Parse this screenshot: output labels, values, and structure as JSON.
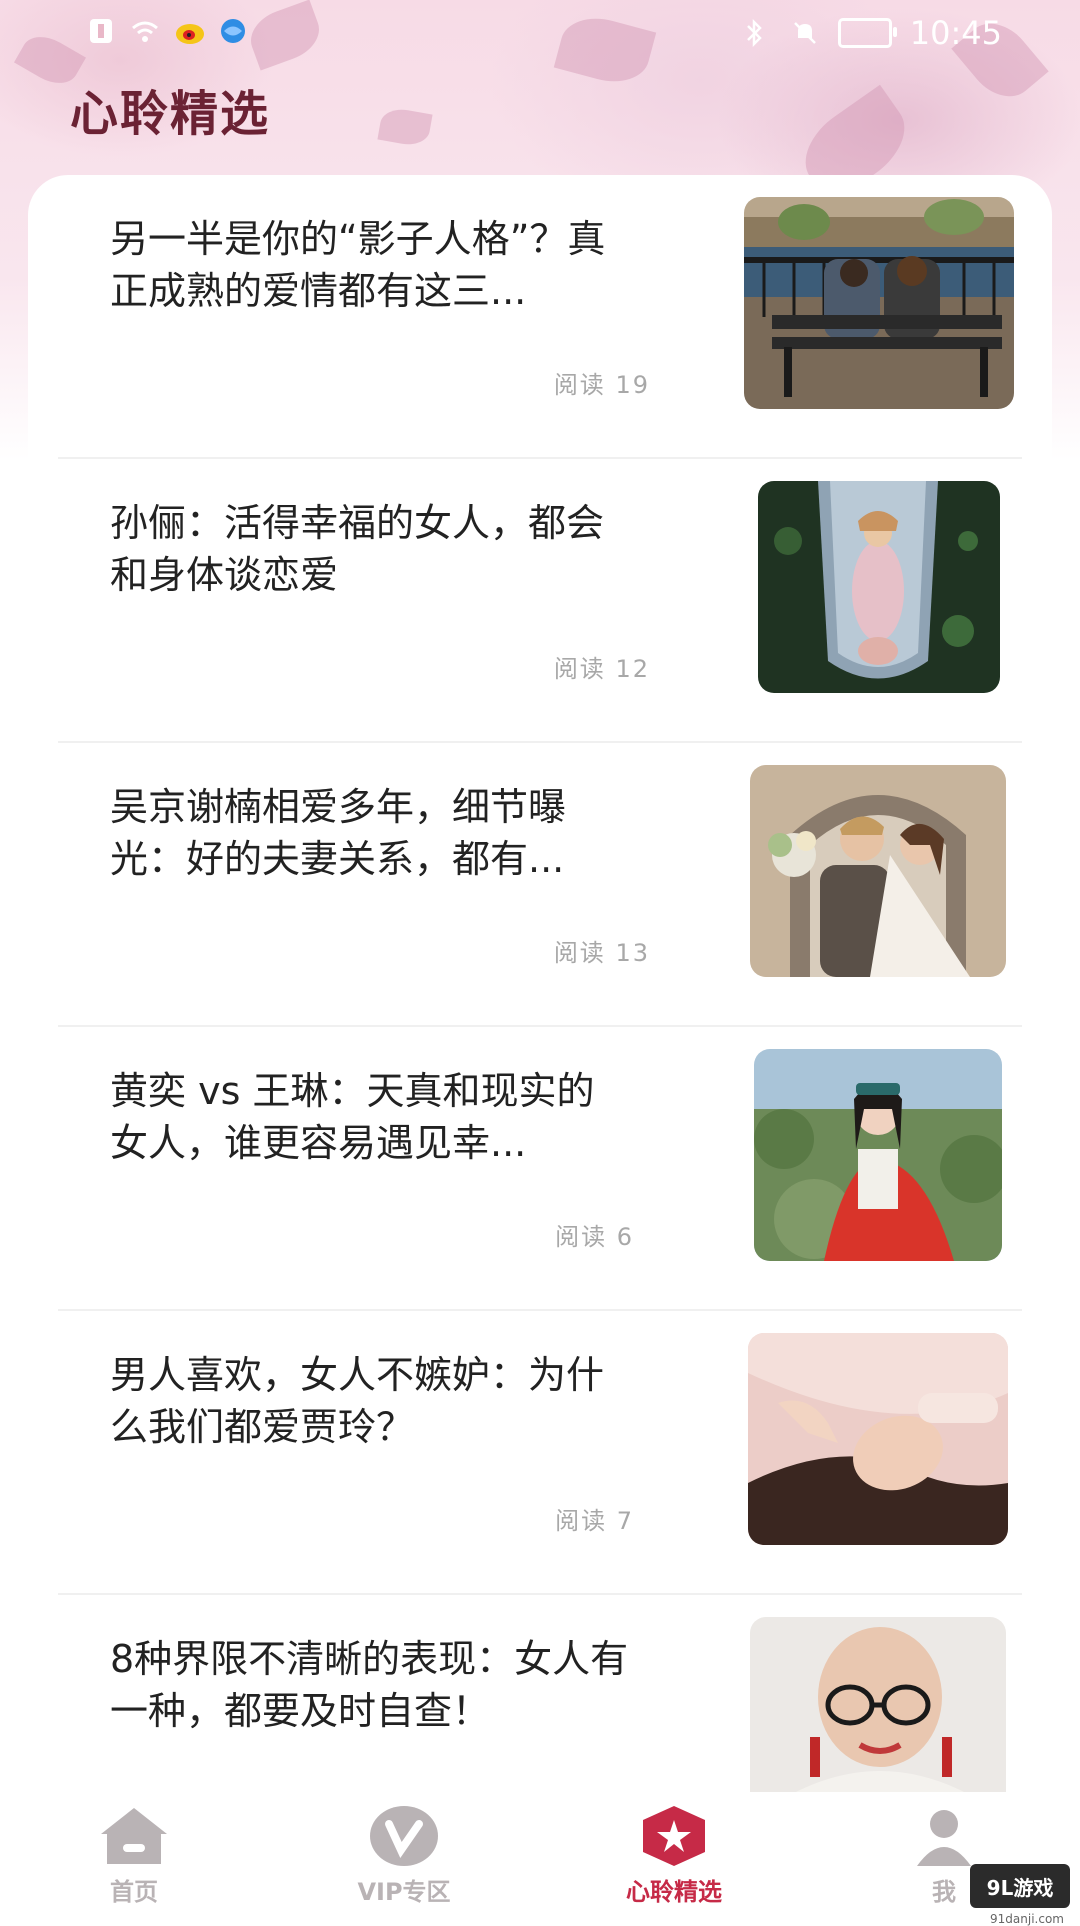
{
  "status_bar": {
    "time": "10:45"
  },
  "header": {
    "title": "心聆精选"
  },
  "articles": [
    {
      "title": "另一半是你的“影子人格”？真正成熟的爱情都有这三...",
      "reads_label": "阅读",
      "reads": "19",
      "image": "couple-on-bench-photo"
    },
    {
      "title": "孙俪：活得幸福的女人，都会和身体谈恋爱",
      "reads_label": "阅读",
      "reads": "12",
      "image": "woman-in-boat-photo"
    },
    {
      "title": "吴京谢楠相爱多年，细节曝光：好的夫妻关系，都有...",
      "reads_label": "阅读",
      "reads": "13",
      "image": "wedding-couple-photo"
    },
    {
      "title": "黄奕 vs 王琳：天真和现实的女人，谁更容易遇见幸...",
      "reads_label": "阅读",
      "reads": "6",
      "image": "woman-red-dress-photo"
    },
    {
      "title": "男人喜欢，女人不嫉妒：为什么我们都爱贾玲？",
      "reads_label": "阅读",
      "reads": "7",
      "image": "woman-lying-photo"
    },
    {
      "title": "8种界限不清晰的表现：女人有一种，都要及时自查！",
      "reads_label": "",
      "reads": "",
      "image": "bald-woman-glasses-photo"
    }
  ],
  "tabbar": {
    "tabs": [
      {
        "label": "首页",
        "icon": "home-icon",
        "active": false
      },
      {
        "label": "VIP专区",
        "icon": "vip-icon",
        "active": false
      },
      {
        "label": "心聆精选",
        "icon": "star-icon",
        "active": true
      },
      {
        "label": "我",
        "icon": "profile-icon",
        "active": false
      }
    ]
  },
  "watermark": {
    "text": "9L游戏",
    "url": "91danji.com"
  },
  "colors": {
    "accent": "#c62a47",
    "title": "#6b2234",
    "inactive": "#b9b3b5"
  }
}
